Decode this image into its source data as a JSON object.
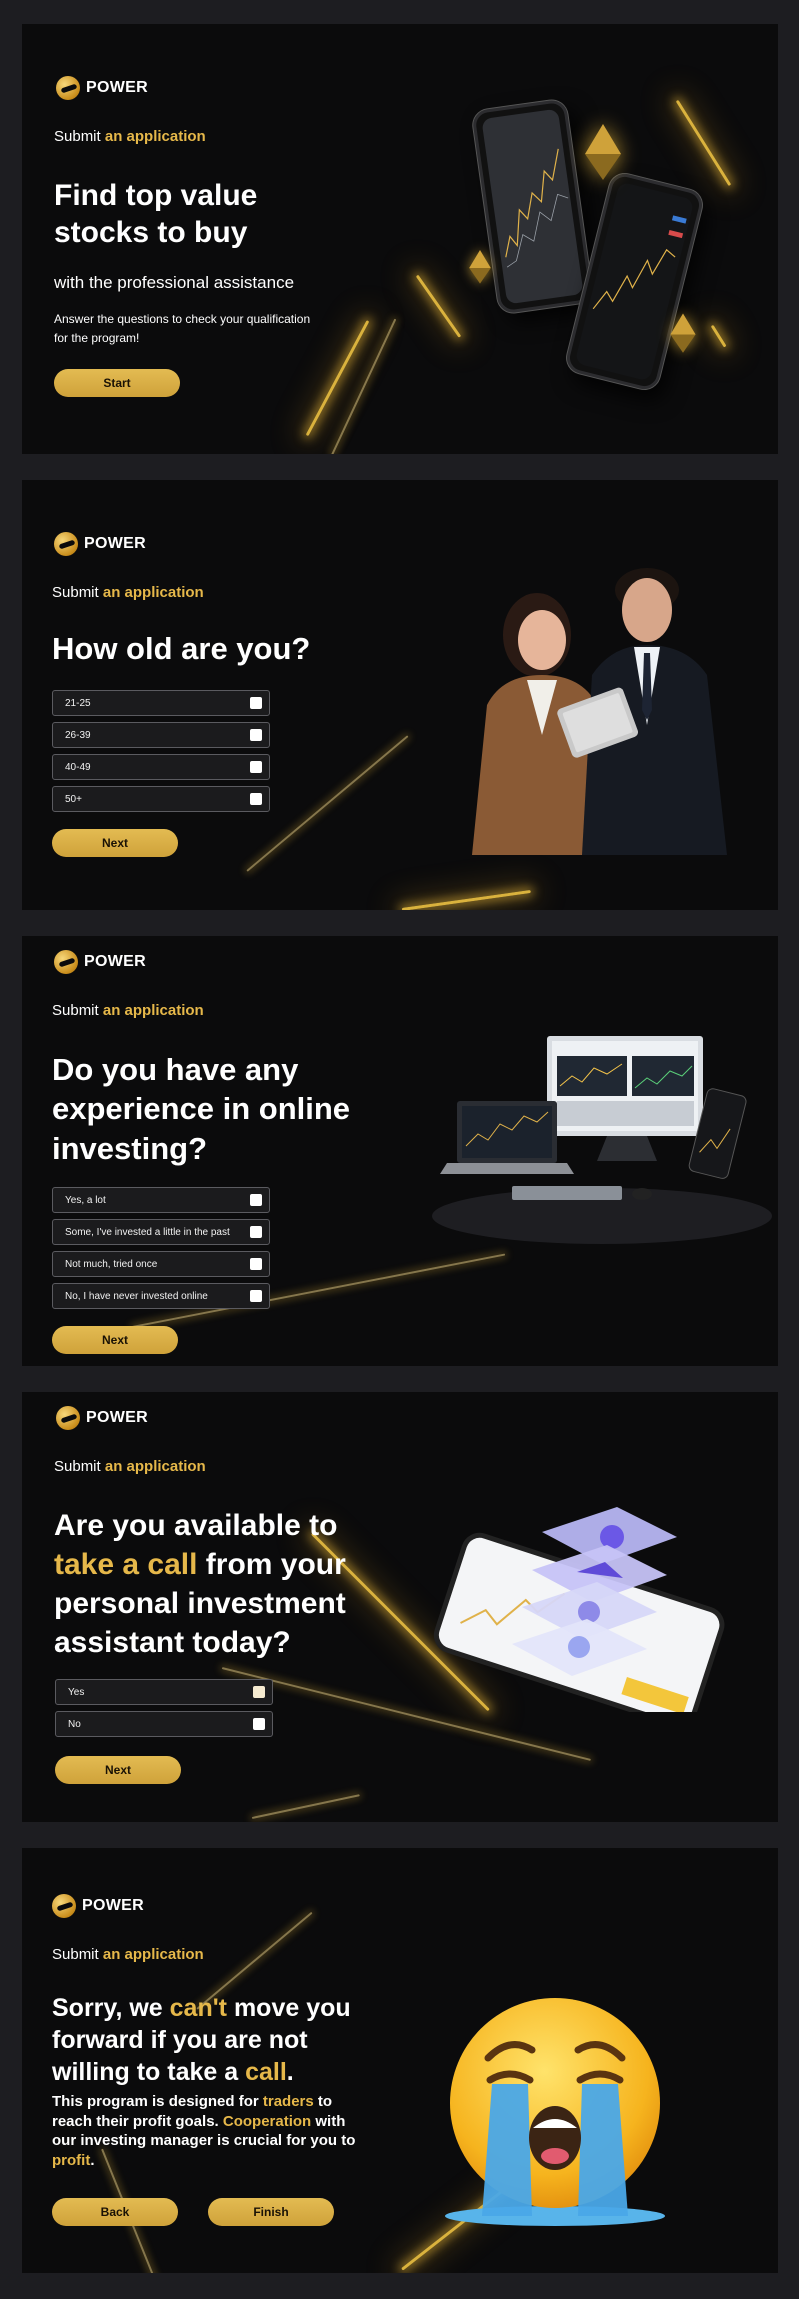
{
  "brand": {
    "name": "POWER"
  },
  "eyebrow": {
    "prefix": "Submit",
    "accent": "an application"
  },
  "colors": {
    "accent": "#e6b84a",
    "button": "#d6aa40",
    "background": "#0b0b0c",
    "page": "#1d1d21"
  },
  "section1": {
    "title_line1": "Find top value",
    "title_line2": "stocks to buy",
    "subtitle": "with the professional assistance",
    "description_line1": "Answer the questions to check your qualification",
    "description_line2": "for the program!",
    "start_label": "Start"
  },
  "section2": {
    "question": "How old are you?",
    "options": [
      "21-25",
      "26-39",
      "40-49",
      "50+"
    ],
    "next_label": "Next"
  },
  "section3": {
    "question_line1": "Do you have any",
    "question_line2": "experience in online",
    "question_line3": "investing?",
    "options": [
      "Yes, a lot",
      "Some, I've invested a little in the past",
      "Not much, tried once",
      "No, I have never invested online"
    ],
    "next_label": "Next"
  },
  "section4": {
    "question_line1": "Are you available to",
    "question_line2_accent": "take a call",
    "question_line2_rest": " from your",
    "question_line3": "personal investment",
    "question_line4": "assistant today?",
    "options": [
      "Yes",
      "No"
    ],
    "next_label": "Next"
  },
  "section5": {
    "title_a": "Sorry, we ",
    "title_b": "can't",
    "title_c": " move you",
    "title_line2": "forward if you are not",
    "title_line3_a": "willing to take a ",
    "title_line3_b": "call",
    "title_line3_c": ".",
    "body_a": "This program is designed for ",
    "body_b": "traders",
    "body_c": " to",
    "body_line2_a": "reach their profit goals. ",
    "body_line2_b": "Cooperation",
    "body_line2_c": " with",
    "body_line3": "our investing manager is crucial for you to",
    "body_line4_a": "profit",
    "body_line4_b": ".",
    "back_label": "Back",
    "finish_label": "Finish"
  },
  "icons": [
    "logo-icon",
    "checkbox-icon",
    "phone-image",
    "crystal-icon",
    "couple-photo",
    "computer-setup-image",
    "crypto-phone-image",
    "crying-emoji"
  ]
}
